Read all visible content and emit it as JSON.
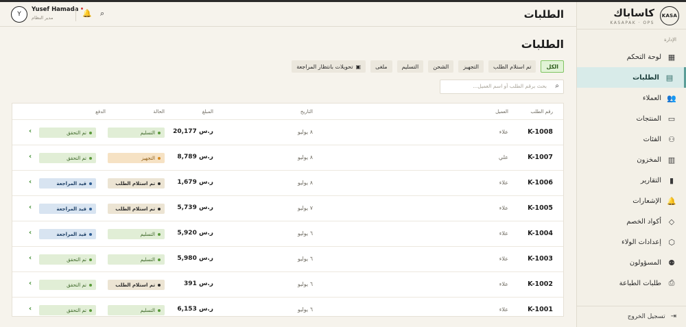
{
  "brand": {
    "logo": "KASA",
    "name_ar": "كاساباك",
    "name_en": "KASAPAK · OPS"
  },
  "sidebar": {
    "section": "الإدارة",
    "items": [
      {
        "label": "لوحة التحكم",
        "icon": "dashboard-icon",
        "glyph": "▦",
        "active": false
      },
      {
        "label": "الطلبات",
        "icon": "orders-icon",
        "glyph": "▤",
        "active": true
      },
      {
        "label": "العملاء",
        "icon": "customers-icon",
        "glyph": "👥",
        "active": false
      },
      {
        "label": "المنتجات",
        "icon": "products-icon",
        "glyph": "▭",
        "active": false
      },
      {
        "label": "الفئات",
        "icon": "categories-icon",
        "glyph": "⚇",
        "active": false
      },
      {
        "label": "المخزون",
        "icon": "inventory-icon",
        "glyph": "▥",
        "active": false
      },
      {
        "label": "التقارير",
        "icon": "reports-icon",
        "glyph": "▮",
        "active": false
      },
      {
        "label": "الإشعارات",
        "icon": "notifications-icon",
        "glyph": "🔔",
        "active": false
      },
      {
        "label": "أكواد الخصم",
        "icon": "discount-tag-icon",
        "glyph": "◇",
        "active": false
      },
      {
        "label": "إعدادات الولاء",
        "icon": "loyalty-icon",
        "glyph": "⬡",
        "active": false
      },
      {
        "label": "المسؤولون",
        "icon": "admins-icon",
        "glyph": "⚉",
        "active": false
      },
      {
        "label": "طلبات الطباعة",
        "icon": "printer-icon",
        "glyph": "⎙",
        "active": false
      }
    ],
    "logout": "تسجيل الخروج"
  },
  "header": {
    "page_title": "الطلبات",
    "avatar_initial": "Y",
    "user_name": "Yusef Hamada",
    "user_role": "مدير النظام"
  },
  "main": {
    "title": "الطلبات",
    "tabs": [
      {
        "label": "الكل",
        "active": true
      },
      {
        "label": "تم استلام الطلب",
        "active": false
      },
      {
        "label": "التجهيز",
        "active": false
      },
      {
        "label": "الشحن",
        "active": false
      },
      {
        "label": "التسليم",
        "active": false
      },
      {
        "label": "ملغى",
        "active": false
      },
      {
        "label": "تحويلات بانتظار المراجعة",
        "active": false
      }
    ],
    "search_placeholder": "بحث برقم الطلب أو اسم العميل..."
  },
  "table": {
    "headers": {
      "id": "رقم الطلب",
      "customer": "العميل",
      "date": "التاريخ",
      "amount": "المبلغ",
      "status": "الحالة",
      "payment": "الدفع"
    },
    "rows": [
      {
        "id": "K-1008",
        "customer": "علاء",
        "date": "٨ يوليو",
        "amount": "20,177 ر.س",
        "status": "التسليم",
        "status_style": "st-green",
        "payment": "تم التحقق",
        "payment_style": "st-green"
      },
      {
        "id": "K-1007",
        "customer": "علي",
        "date": "٨ يوليو",
        "amount": "8,789 ر.س",
        "status": "التجهيز",
        "status_style": "st-orange",
        "payment": "تم التحقق",
        "payment_style": "st-green"
      },
      {
        "id": "K-1006",
        "customer": "علاء",
        "date": "٨ يوليو",
        "amount": "1,679 ر.س",
        "status": "تم استلام الطلب",
        "status_style": "st-beige",
        "payment": "قيد المراجعة",
        "payment_style": "st-blue"
      },
      {
        "id": "K-1005",
        "customer": "علاء",
        "date": "٧ يوليو",
        "amount": "5,739 ر.س",
        "status": "تم استلام الطلب",
        "status_style": "st-beige",
        "payment": "قيد المراجعة",
        "payment_style": "st-blue"
      },
      {
        "id": "K-1004",
        "customer": "علاء",
        "date": "٦ يوليو",
        "amount": "5,920 ر.س",
        "status": "التسليم",
        "status_style": "st-green",
        "payment": "قيد المراجعة",
        "payment_style": "st-blue"
      },
      {
        "id": "K-1003",
        "customer": "علاء",
        "date": "٦ يوليو",
        "amount": "5,980 ر.س",
        "status": "التسليم",
        "status_style": "st-green",
        "payment": "تم التحقق",
        "payment_style": "st-green"
      },
      {
        "id": "K-1002",
        "customer": "علاء",
        "date": "٦ يوليو",
        "amount": "391 ر.س",
        "status": "تم استلام الطلب",
        "status_style": "st-beige",
        "payment": "تم التحقق",
        "payment_style": "st-green"
      },
      {
        "id": "K-1001",
        "customer": "علاء",
        "date": "٦ يوليو",
        "amount": "6,153 ر.س",
        "status": "التسليم",
        "status_style": "st-green",
        "payment": "تم التحقق",
        "payment_style": "st-green"
      }
    ]
  }
}
